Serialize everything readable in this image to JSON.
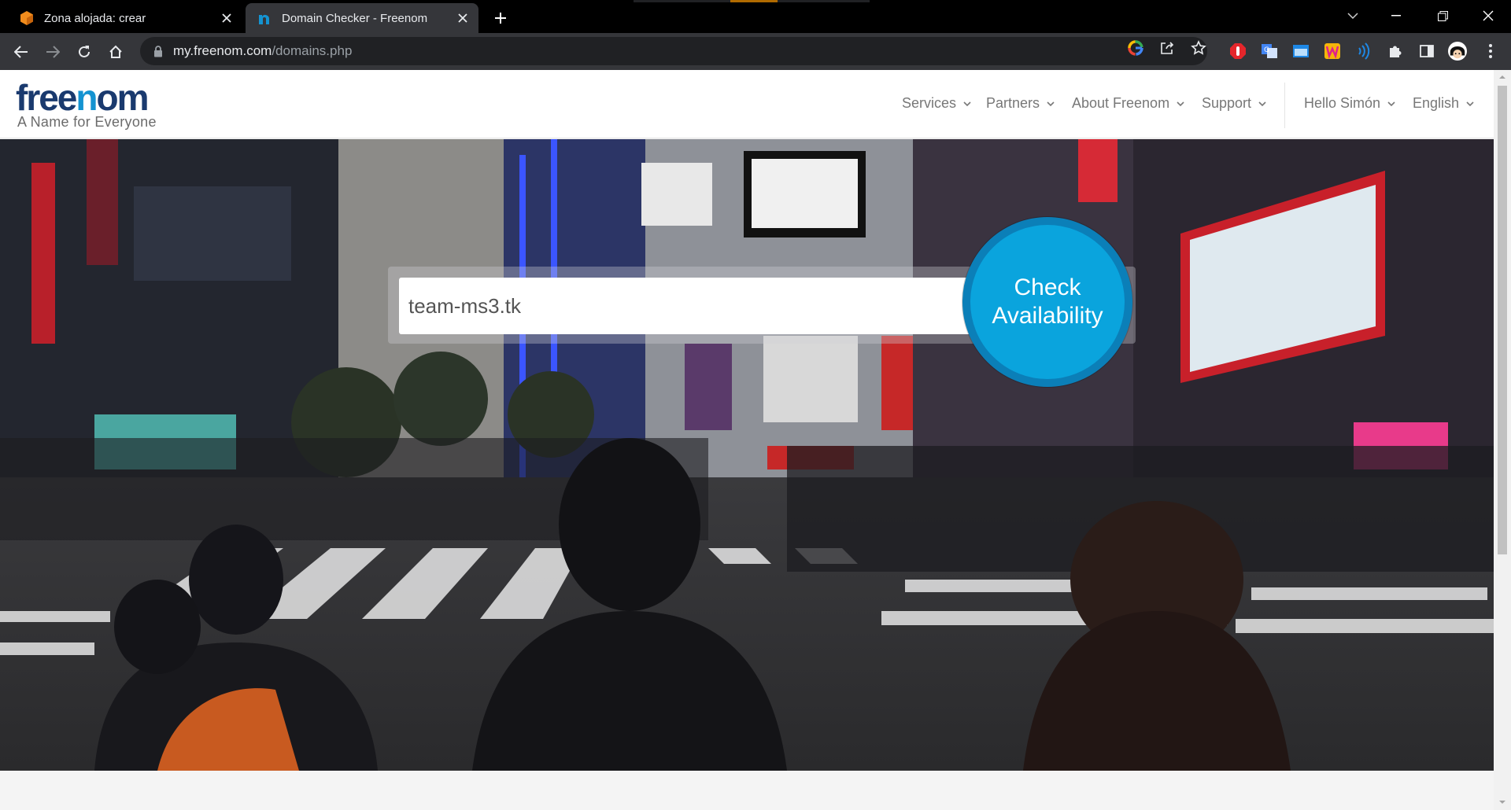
{
  "browser": {
    "tabs": [
      {
        "title": "Zona alojada: crear",
        "icon": "aws-box-icon",
        "active": false
      },
      {
        "title": "Domain Checker - Freenom",
        "icon": "freenom-n-icon",
        "active": true
      }
    ],
    "url_host": "my.freenom.com",
    "url_path": "/domains.php"
  },
  "site": {
    "logo_word_a": "free",
    "logo_word_b": "n",
    "logo_word_c": "om",
    "tagline": "A Name for Everyone",
    "nav": {
      "services": "Services",
      "partners": "Partners",
      "about": "About Freenom",
      "support": "Support",
      "user": "Hello Simón",
      "language": "English"
    },
    "colors": {
      "brand_dark": "#1a3a6e",
      "brand_blue": "#1493d1",
      "button": "#0aa4dd"
    }
  },
  "search": {
    "value": "team-ms3.tk",
    "button_line1": "Check",
    "button_line2": "Availability"
  }
}
